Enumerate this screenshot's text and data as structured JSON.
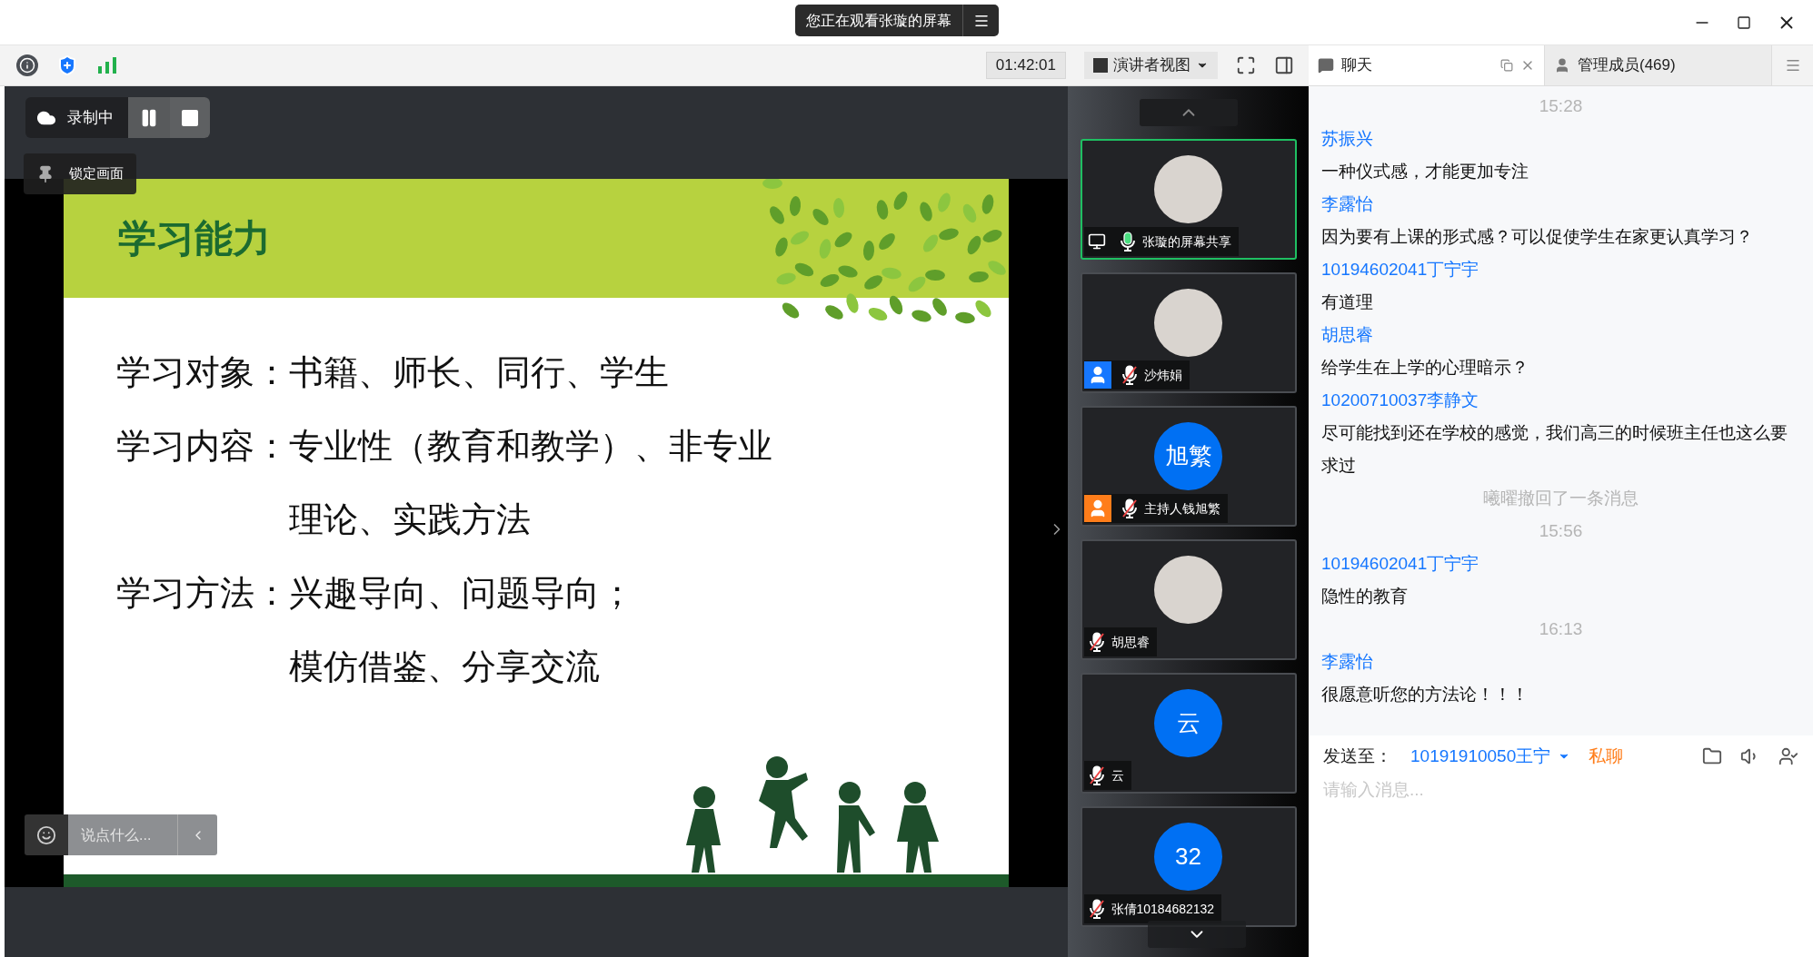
{
  "banner": {
    "text": "您正在观看张璇的屏幕"
  },
  "toolbar": {
    "timer": "01:42:01",
    "view_mode": "演讲者视图"
  },
  "side_tabs": [
    {
      "label": "聊天",
      "selected": true
    },
    {
      "label": "管理成员(469)",
      "selected": false
    }
  ],
  "recording": {
    "label": "录制中"
  },
  "lock_button": {
    "label": "锁定画面"
  },
  "slide": {
    "title": "学习能力",
    "items": [
      {
        "label": "学习对象：",
        "lines": [
          "书籍、师长、同行、学生"
        ]
      },
      {
        "label": "学习内容：",
        "lines": [
          "专业性（教育和教学）、非专业",
          "理论、实践方法"
        ]
      },
      {
        "label": "学习方法：",
        "lines": [
          "兴趣导向、问题导向；",
          "模仿借鉴、分享交流"
        ]
      }
    ]
  },
  "comment_box": {
    "placeholder": "说点什么..."
  },
  "participants": [
    {
      "name": "张璇的屏幕共享",
      "avatar": {
        "kind": "picture"
      },
      "badge": {
        "kind": "screen"
      },
      "mic_muted": false,
      "selected": true
    },
    {
      "name": "沙炜娟",
      "avatar": {
        "kind": "picture"
      },
      "badge": {
        "kind": "member"
      },
      "mic_muted": true,
      "selected": false
    },
    {
      "name": "主持人钱旭繁",
      "avatar": {
        "kind": "initials",
        "text": "旭繁"
      },
      "badge": {
        "kind": "host"
      },
      "mic_muted": true,
      "selected": false
    },
    {
      "name": "胡思睿",
      "avatar": {
        "kind": "picture"
      },
      "mic_muted": true,
      "selected": false
    },
    {
      "name": "云",
      "avatar": {
        "kind": "initials",
        "text": "云"
      },
      "mic_muted": true,
      "selected": false
    },
    {
      "name": "张倩10184682132",
      "avatar": {
        "kind": "initials",
        "text": "32"
      },
      "mic_muted": true,
      "selected": false
    }
  ],
  "chat": {
    "messages": [
      {
        "kind": "time",
        "text": "15:28"
      },
      {
        "kind": "sender",
        "text": "苏振兴"
      },
      {
        "kind": "text",
        "text": "一种仪式感，才能更加专注"
      },
      {
        "kind": "sender",
        "text": "李露怡"
      },
      {
        "kind": "text",
        "text": "因为要有上课的形式感？可以促使学生在家更认真学习？"
      },
      {
        "kind": "sender",
        "text": "10194602041丁宁宇"
      },
      {
        "kind": "text",
        "text": "有道理"
      },
      {
        "kind": "sender",
        "text": "胡思睿"
      },
      {
        "kind": "text",
        "text": "给学生在上学的心理暗示？"
      },
      {
        "kind": "sender",
        "text": "10200710037李静文"
      },
      {
        "kind": "text",
        "text": "尽可能找到还在学校的感觉，我们高三的时候班主任也这么要求过"
      },
      {
        "kind": "notice",
        "text": "曦曜撤回了一条消息"
      },
      {
        "kind": "time",
        "text": "15:56"
      },
      {
        "kind": "sender",
        "text": "10194602041丁宁宇"
      },
      {
        "kind": "text",
        "text": "隐性的教育"
      },
      {
        "kind": "time",
        "text": "16:13"
      },
      {
        "kind": "sender",
        "text": "李露怡"
      },
      {
        "kind": "text",
        "text": "很愿意听您的方法论！！！"
      }
    ]
  },
  "composer": {
    "label": "发送至：",
    "recipient": "10191910050王宁",
    "private": "私聊",
    "placeholder": "请输入消息..."
  }
}
